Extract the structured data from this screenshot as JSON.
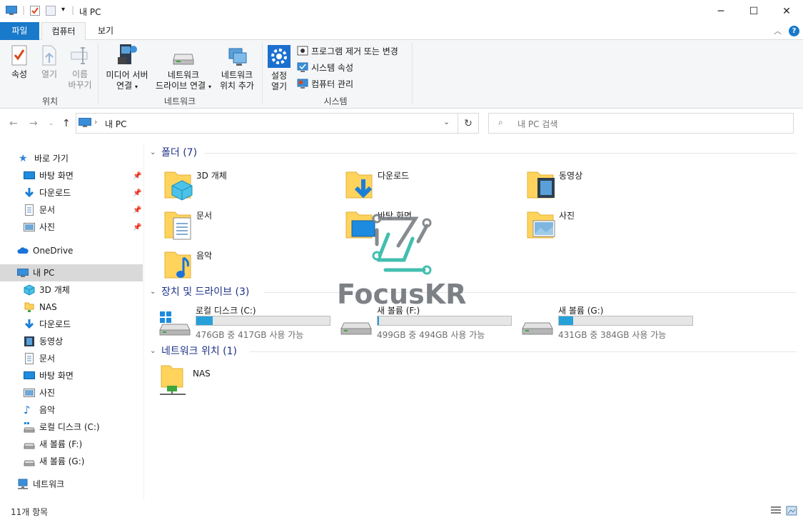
{
  "window": {
    "title": "내 PC"
  },
  "ribbon_tabs": [
    {
      "label": "파일"
    },
    {
      "label": "컴퓨터"
    },
    {
      "label": "보기"
    }
  ],
  "ribbon": {
    "location": {
      "label": "위치",
      "properties": "속성",
      "open": "열기",
      "rename_1": "이름",
      "rename_2": "바꾸기"
    },
    "network": {
      "label": "네트워크",
      "media_1": "미디어 서버",
      "media_2": "연결",
      "map_1": "네트워크",
      "map_2": "드라이브 연결",
      "add_1": "네트워크",
      "add_2": "위치 추가"
    },
    "system": {
      "label": "시스템",
      "settings_1": "설정",
      "settings_2": "열기",
      "uninstall": "프로그램 제거 또는 변경",
      "properties": "시스템 속성",
      "manage": "컴퓨터 관리"
    }
  },
  "address": {
    "path": "내 PC",
    "search_placeholder": "내 PC 검색"
  },
  "nav": {
    "quick_access": "바로 가기",
    "quick_items": [
      {
        "label": "바탕 화면",
        "icon": "desktop-icon"
      },
      {
        "label": "다운로드",
        "icon": "download-icon"
      },
      {
        "label": "문서",
        "icon": "document-icon"
      },
      {
        "label": "사진",
        "icon": "picture-icon"
      }
    ],
    "onedrive": "OneDrive",
    "this_pc": "내 PC",
    "pc_items": [
      {
        "label": "3D 개체",
        "icon": "3d-objects-icon"
      },
      {
        "label": "NAS",
        "icon": "nas-icon"
      },
      {
        "label": "다운로드",
        "icon": "download-icon"
      },
      {
        "label": "동영상",
        "icon": "video-icon"
      },
      {
        "label": "문서",
        "icon": "document-icon"
      },
      {
        "label": "바탕 화면",
        "icon": "desktop-icon"
      },
      {
        "label": "사진",
        "icon": "picture-icon"
      },
      {
        "label": "음악",
        "icon": "music-icon"
      },
      {
        "label": "로컬 디스크 (C:)",
        "icon": "local-disk-icon"
      },
      {
        "label": "새 볼륨 (F:)",
        "icon": "drive-icon"
      },
      {
        "label": "새 볼륨 (G:)",
        "icon": "drive-icon"
      }
    ],
    "network": "네트워크"
  },
  "content": {
    "folders_header": "폴더 (7)",
    "folders": [
      {
        "name": "3D 개체"
      },
      {
        "name": "다운로드"
      },
      {
        "name": "동영상"
      },
      {
        "name": "문서"
      },
      {
        "name": "바탕 화면"
      },
      {
        "name": "사진"
      },
      {
        "name": "음악"
      }
    ],
    "drives_header": "장치 및 드라이브 (3)",
    "drives": [
      {
        "name": "로컬 디스크 (C:)",
        "free": "476GB 중 417GB 사용 가능",
        "used_fraction": 0.124
      },
      {
        "name": "새 볼륨 (F:)",
        "free": "499GB 중 494GB 사용 가능",
        "used_fraction": 0.01
      },
      {
        "name": "새 볼륨 (G:)",
        "free": "431GB 중 384GB 사용 가능",
        "used_fraction": 0.109
      }
    ],
    "network_header": "네트워크 위치 (1)",
    "network_locations": [
      {
        "name": "NAS"
      }
    ]
  },
  "status": {
    "item_count": "11개 항목"
  },
  "watermark": {
    "text": "FocusKR"
  },
  "colors": {
    "accent": "#1979ca",
    "folder": "#ffd35c",
    "drive_bar": "#26a0da",
    "section_header": "#1e3287"
  }
}
